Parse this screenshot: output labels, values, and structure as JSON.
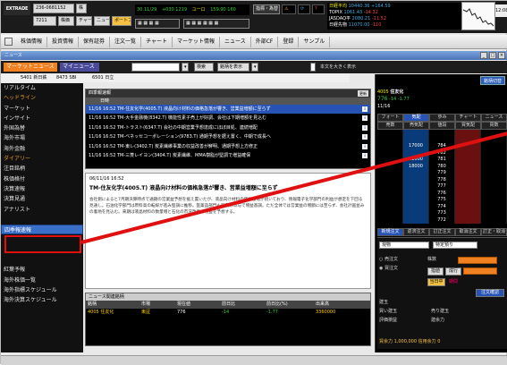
{
  "topbar": {
    "logo": "EXTRADE",
    "account": "236-0681152",
    "account_suffix": "株",
    "code": "7211",
    "buttons": [
      "株価",
      "チャート",
      "ニュース",
      "ポートフォリオ"
    ],
    "ticker": [
      "30.11/29",
      "+030 1219",
      "ユーロ",
      "159.90 160"
    ],
    "index_head": [
      "指標・為替",
      "日経平均"
    ],
    "index_rows": [
      {
        "name": "TOPIX",
        "value": "1061.43",
        "change": "-14.32"
      },
      {
        "name": "JASDAQ平",
        "value": "2080.21",
        "change": "-11.52"
      },
      {
        "name": "日経先物",
        "value": "11070.00",
        "change": "-110"
      }
    ],
    "nikkei_value": "10440.36 +164.59",
    "clock": "12:08"
  },
  "menu": [
    "株価情報",
    "投資情報",
    "保有証券",
    "注文一覧",
    "チャート",
    "マーケット情報",
    "ニュース",
    "外部CF",
    "登録",
    "サンプル"
  ],
  "window_title": "ニュース",
  "newsbar": {
    "tab_market": "マーケットニュース",
    "tab_my": "マイニュース",
    "search_button": "検索",
    "sort_label": "銘柄を表示",
    "checkbox_label": "本文を大きく表示"
  },
  "codestrip": [
    "5401 新日鉄",
    "8473 SBI",
    "6501 日立"
  ],
  "sidebar": {
    "items": [
      {
        "label": "リアルタイム",
        "style": "normal"
      },
      {
        "label": "ヘッドライン",
        "style": "orange"
      },
      {
        "label": "マーケット",
        "style": "normal"
      },
      {
        "label": "インサイト",
        "style": "normal"
      },
      {
        "label": "外国為替",
        "style": "normal"
      },
      {
        "label": "海外市場",
        "style": "normal"
      },
      {
        "label": "海外金融",
        "style": "normal"
      },
      {
        "label": "ダイアリー",
        "style": "orange"
      },
      {
        "label": "注目銘柄",
        "style": "normal"
      },
      {
        "label": "株価格付",
        "style": "normal"
      },
      {
        "label": "決算速報",
        "style": "normal"
      },
      {
        "label": "決算見通",
        "style": "normal"
      },
      {
        "label": "アナリスト",
        "style": "normal"
      },
      {
        "label": "",
        "style": "normal"
      },
      {
        "label": "四季報速報",
        "style": "active"
      },
      {
        "label": "",
        "style": "normal"
      },
      {
        "label": "",
        "style": "normal"
      },
      {
        "label": "",
        "style": "normal"
      },
      {
        "label": "紅葉予報",
        "style": "normal"
      },
      {
        "label": "海外株価一覧",
        "style": "normal"
      },
      {
        "label": "海外指標スケジュール",
        "style": "normal"
      },
      {
        "label": "海外決算スケジュール",
        "style": "normal"
      }
    ]
  },
  "newslist": {
    "title": "四季報速報",
    "update_button": "更新",
    "header": "日時",
    "rows": [
      {
        "text": "11/16 16:52 TM-住友化学(4005.T) 液晶向け材料の価格急落が響き、営業益増額に至らず",
        "selected": true
      },
      {
        "text": "11/16 16:52 TM-大手金融機(8342.T) 機能性素子売上が好調、会社は下期増額を見込む",
        "selected": false
      },
      {
        "text": "11/16 16:52 TM-トラスト(6347.T) 会社の中期営業予想達成にほぼ目処、連続増配",
        "selected": false
      },
      {
        "text": "11/16 16:52 TM-ベネッセコーポレーション(9783.T) 通期予想を据え置く、中期で成長へ",
        "selected": false
      },
      {
        "text": "11/16 16:52 TM-東レ(3402.T) 炭素繊維事業の収益改善が鮮明、通期予想上方修正",
        "selected": false
      },
      {
        "text": "11/16 16:52 TM-三菱レイヨン(3404.T) 炭素繊維、MMA樹脂が堅調で増益確保",
        "selected": false
      }
    ]
  },
  "article": {
    "date": "06/11/16 16:52",
    "title": "TM-住友化学(4005.T) 液晶向け材料の価格急落が響き、営業益増額に至らず",
    "body": "会社側によると7月期決算時点で通期の営業益予想を据え置いたが、液晶向け材料の価格急落が続いており、情報電子化学部門の利益が想定を下回る見通し。石油化学部門は原料高の転嫁が進み堅調に推移。医薬品部門も新薬の寄与で増益基調。ただ全体では営業益の増額には至らず、会社計画並みの着地を見込む。来期は液晶材料の数量増と石化の市況改善で増益を予想する。"
  },
  "related": {
    "title": "ニュース関連銘柄",
    "headers": [
      "銘柄",
      "市場",
      "現在値",
      "前日比",
      "前日比(%)",
      "出来高"
    ],
    "row": [
      "4005 住友化",
      "東証",
      "776",
      "-14",
      "-1.77",
      "3360000"
    ]
  },
  "rpanel": {
    "top_button": "銘柄切替",
    "stock_code": "4005",
    "stock_name": "住友化",
    "price": "776",
    "change": "-14",
    "change_pct": "-1.77",
    "time_label": "11/16",
    "tabs1": [
      "フォート",
      "気配",
      "歩み",
      "チャート",
      "ニュース"
    ],
    "tabs2": [
      "売数",
      "売気配",
      "値段",
      "買気配",
      "買数"
    ],
    "board": [
      [
        "",
        "",
        "",
        "",
        ""
      ],
      [
        "",
        "",
        "",
        "",
        ""
      ],
      [
        "",
        "17000",
        "784",
        "",
        ""
      ],
      [
        "",
        "",
        "782",
        "",
        ""
      ],
      [
        "",
        "11000",
        "781",
        "",
        ""
      ],
      [
        "",
        "18000",
        "780",
        "",
        ""
      ],
      [
        "",
        "",
        "779",
        "",
        ""
      ],
      [
        "",
        "",
        "778",
        "",
        ""
      ],
      [
        "",
        "",
        "777",
        "",
        ""
      ],
      [
        "",
        "",
        "776",
        "",
        ""
      ],
      [
        "",
        "",
        "775",
        "",
        ""
      ],
      [
        "",
        "",
        "774",
        "",
        ""
      ],
      [
        "",
        "",
        "773",
        "",
        ""
      ],
      [
        "",
        "",
        "772",
        "",
        ""
      ]
    ],
    "order_tabs": [
      "新規注文",
      "返済注文",
      "訂正注文",
      "取消注文",
      "訂正・取消"
    ],
    "order_labels": {
      "type": "現物",
      "account": "特定預り",
      "sell": "売注文",
      "buy": "買注文",
      "condition": "成行",
      "price_label": "価格",
      "qty_label": "株数",
      "limit": "指値",
      "market": "成行",
      "period": "期間",
      "today": "当日中",
      "confirm": "注文確認",
      "position": "建玉",
      "margin_rows": [
        "買い建玉",
        "売り建玉",
        "評価損益",
        "建余力"
      ],
      "bottom": "買余力 1,000,000  信用余力 0"
    }
  },
  "colors": {
    "accent_blue": "#2753b4",
    "highlight_red": "#e01010",
    "sidebar_orange": "#e89a2c"
  }
}
